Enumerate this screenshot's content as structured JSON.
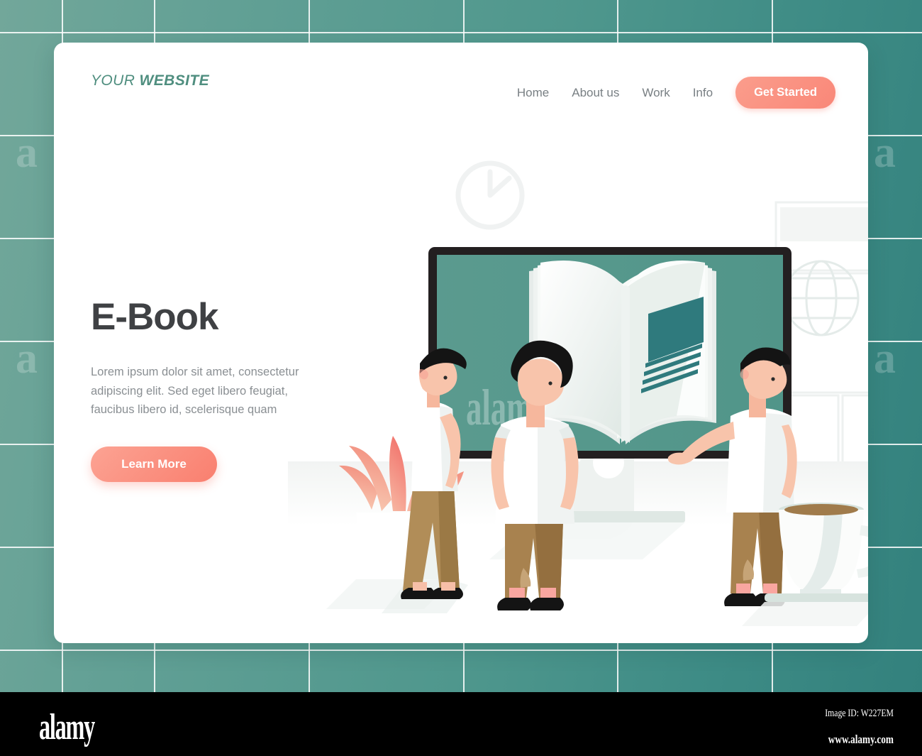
{
  "background": {
    "tile_color_light": "#72a79a",
    "tile_color_dark": "#33817d",
    "grid_line_color": "#ffffff",
    "watermark_letter": "a",
    "vertical_lines": [
      87,
      217,
      435,
      653,
      870,
      1088
    ],
    "horizontal_lines": [
      45,
      190,
      335,
      480,
      625,
      770,
      915
    ]
  },
  "card": {
    "background": "#ffffff"
  },
  "header": {
    "logo": {
      "first": "YOUR ",
      "second": "WEBSITE",
      "color": "#4f8e7f"
    },
    "nav_items": [
      {
        "label": "Home"
      },
      {
        "label": "About us"
      },
      {
        "label": "Work"
      },
      {
        "label": "Info"
      }
    ],
    "cta": {
      "label": "Get Started",
      "color": "#f98778"
    }
  },
  "hero": {
    "title": "E-Book",
    "paragraph": "Lorem ipsum dolor sit amet, consectetur adipiscing elit. Sed eget libero feugiat, faucibus libero id, scelerisque quam",
    "button": {
      "label": "Learn More",
      "color": "#f97f6f"
    }
  },
  "illustration": {
    "monitor": {
      "frame_color": "#231f20",
      "screen_color": "#519589",
      "content": "open-book"
    },
    "book": {
      "page_color": "#f4f7f5",
      "image_box_color": "#2f7a7d",
      "text_line_color": "#2f7a7d"
    },
    "characters": [
      {
        "name": "woman-bob-haircut",
        "hair": "#141414",
        "shirt": "#ffffff",
        "pants": "#b18d58",
        "shoes": "#141414"
      },
      {
        "name": "man-curly-hair",
        "hair": "#141414",
        "shirt": "#ffffff",
        "pants": "#a8824f",
        "shoes": "#141414"
      },
      {
        "name": "man-pointing",
        "hair": "#141414",
        "shirt": "#ffffff",
        "pants": "#a8824f",
        "shoes": "#141414"
      }
    ],
    "props": [
      {
        "name": "potted-plant",
        "leaf_color": "#f4897f",
        "pot_color": "#ffffff"
      },
      {
        "name": "coffee-cup",
        "cup_color": "#fbfcfb",
        "coffee_color": "#a07b4b",
        "saucer_color": "#d7e3de"
      },
      {
        "name": "wall-clock",
        "color": "#f0f2f2"
      },
      {
        "name": "globe-and-paper-plane",
        "color": "#e4ebe9"
      },
      {
        "name": "wall-frames",
        "color": "#eef1f0"
      }
    ]
  },
  "footer": {
    "brand": "alamy",
    "image_id_label": "Image ID: W227EM",
    "website": "www.alamy.com"
  }
}
